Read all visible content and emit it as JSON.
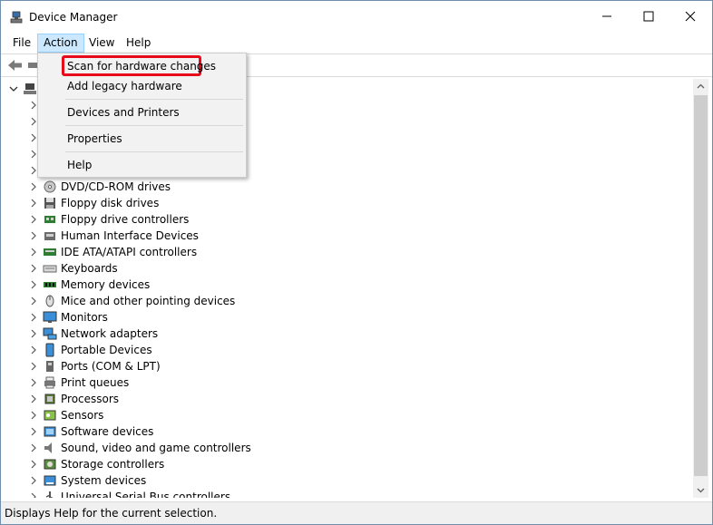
{
  "window": {
    "title": "Device Manager",
    "icon": "device-manager-icon"
  },
  "menubar": {
    "items": [
      {
        "label": "File"
      },
      {
        "label": "Action"
      },
      {
        "label": "View"
      },
      {
        "label": "Help"
      }
    ],
    "active": "Action"
  },
  "action_menu": {
    "items": [
      {
        "label": "Scan for hardware changes",
        "highlighted": true
      },
      {
        "label": "Add legacy hardware"
      },
      {
        "label": "Devices and Printers"
      },
      {
        "label": "Properties"
      },
      {
        "label": "Help"
      }
    ]
  },
  "tree": {
    "root_icon": "computer-icon",
    "items": [
      {
        "label": "",
        "icon": "device-icon"
      },
      {
        "label": "",
        "icon": "device-icon"
      },
      {
        "label": "",
        "icon": "device-icon"
      },
      {
        "label": "",
        "icon": "device-icon"
      },
      {
        "label": "",
        "icon": "device-icon"
      },
      {
        "label": "DVD/CD-ROM drives",
        "icon": "dvd-drive-icon"
      },
      {
        "label": "Floppy disk drives",
        "icon": "floppy-disk-icon"
      },
      {
        "label": "Floppy drive controllers",
        "icon": "floppy-controller-icon"
      },
      {
        "label": "Human Interface Devices",
        "icon": "hid-icon"
      },
      {
        "label": "IDE ATA/ATAPI controllers",
        "icon": "ide-controller-icon"
      },
      {
        "label": "Keyboards",
        "icon": "keyboard-icon"
      },
      {
        "label": "Memory devices",
        "icon": "memory-icon"
      },
      {
        "label": "Mice and other pointing devices",
        "icon": "mouse-icon"
      },
      {
        "label": "Monitors",
        "icon": "monitor-icon"
      },
      {
        "label": "Network adapters",
        "icon": "network-adapter-icon"
      },
      {
        "label": "Portable Devices",
        "icon": "portable-device-icon"
      },
      {
        "label": "Ports (COM & LPT)",
        "icon": "port-icon"
      },
      {
        "label": "Print queues",
        "icon": "printer-icon"
      },
      {
        "label": "Processors",
        "icon": "processor-icon"
      },
      {
        "label": "Sensors",
        "icon": "sensor-icon"
      },
      {
        "label": "Software devices",
        "icon": "software-device-icon"
      },
      {
        "label": "Sound, video and game controllers",
        "icon": "sound-icon"
      },
      {
        "label": "Storage controllers",
        "icon": "storage-controller-icon"
      },
      {
        "label": "System devices",
        "icon": "system-device-icon"
      },
      {
        "label": "Universal Serial Bus controllers",
        "icon": "usb-icon"
      }
    ]
  },
  "statusbar": {
    "text": "Displays Help for the current selection."
  },
  "colors": {
    "highlight_border": "#e8091a",
    "menu_active_bg": "#cce8ff",
    "dropdown_bg": "#f2f2f2"
  }
}
